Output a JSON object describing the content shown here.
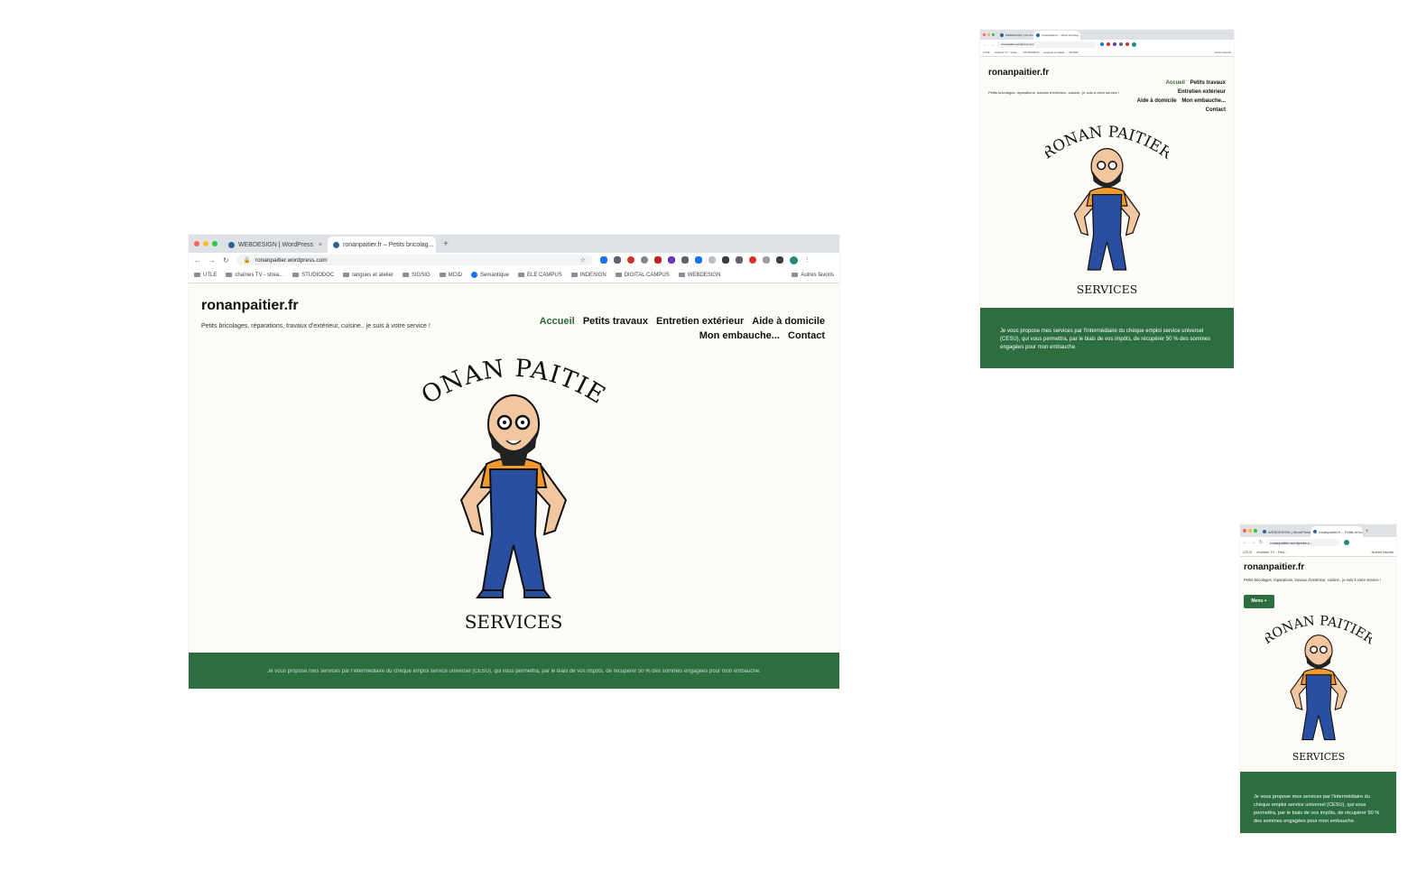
{
  "colors": {
    "accent_green": "#2c6e40",
    "current_menu": "#2a6a3c",
    "page_bg": "#fcfbf6",
    "chrome_bg": "#dee1e6"
  },
  "browser": {
    "tabs": [
      {
        "title": "WEBDESIGN | WordPress",
        "favicon": "wordpress-icon"
      },
      {
        "title": "ronanpaitier.fr – Petits bricolag...",
        "favicon": "wordpress-icon"
      }
    ],
    "new_tab_label": "+",
    "close_label": "×",
    "url": "ronanpaitier.wordpress.com",
    "url_small": "ronanpaitier.wordpress.c...",
    "bookmarks": [
      "UTLE",
      "chaînes TV - strea...",
      "STUDIODOC",
      "langues et atelier",
      "SIGSIG",
      "MCID",
      "Semantique",
      "ELE CAMPUS",
      "INDESIGN",
      "DIGITAL CAMPUS",
      "WEBDESIGN"
    ],
    "bookmarks_small": [
      "UTLE",
      "chaînes TV - Ros..."
    ],
    "other_bookmarks": "Autres favoris",
    "other_bookmarks_small": "Autres favoris",
    "nav_icons": [
      "back-icon",
      "forward-icon",
      "reload-icon"
    ]
  },
  "site": {
    "title": "ronanpaitier.fr",
    "tagline": "Petits bricolages, réparations, travaux d'extérieur, cuisine.. je suis à votre service !",
    "menu": [
      "Accueil",
      "Petits travaux",
      "Entretien extérieur",
      "Aide à domicile",
      "Mon embauche...",
      "Contact"
    ],
    "menu_button": "Menu +",
    "logo_top": "RONAN PAITIER",
    "logo_bottom": "SERVICES",
    "intro": "Je vous propose mes services par l'intermédiaire du chèque emploi service universel (CESU), qui vous permettra, par le biais de vos impôts, de récupérer 50 % des sommes engagées pour mon embauche."
  }
}
